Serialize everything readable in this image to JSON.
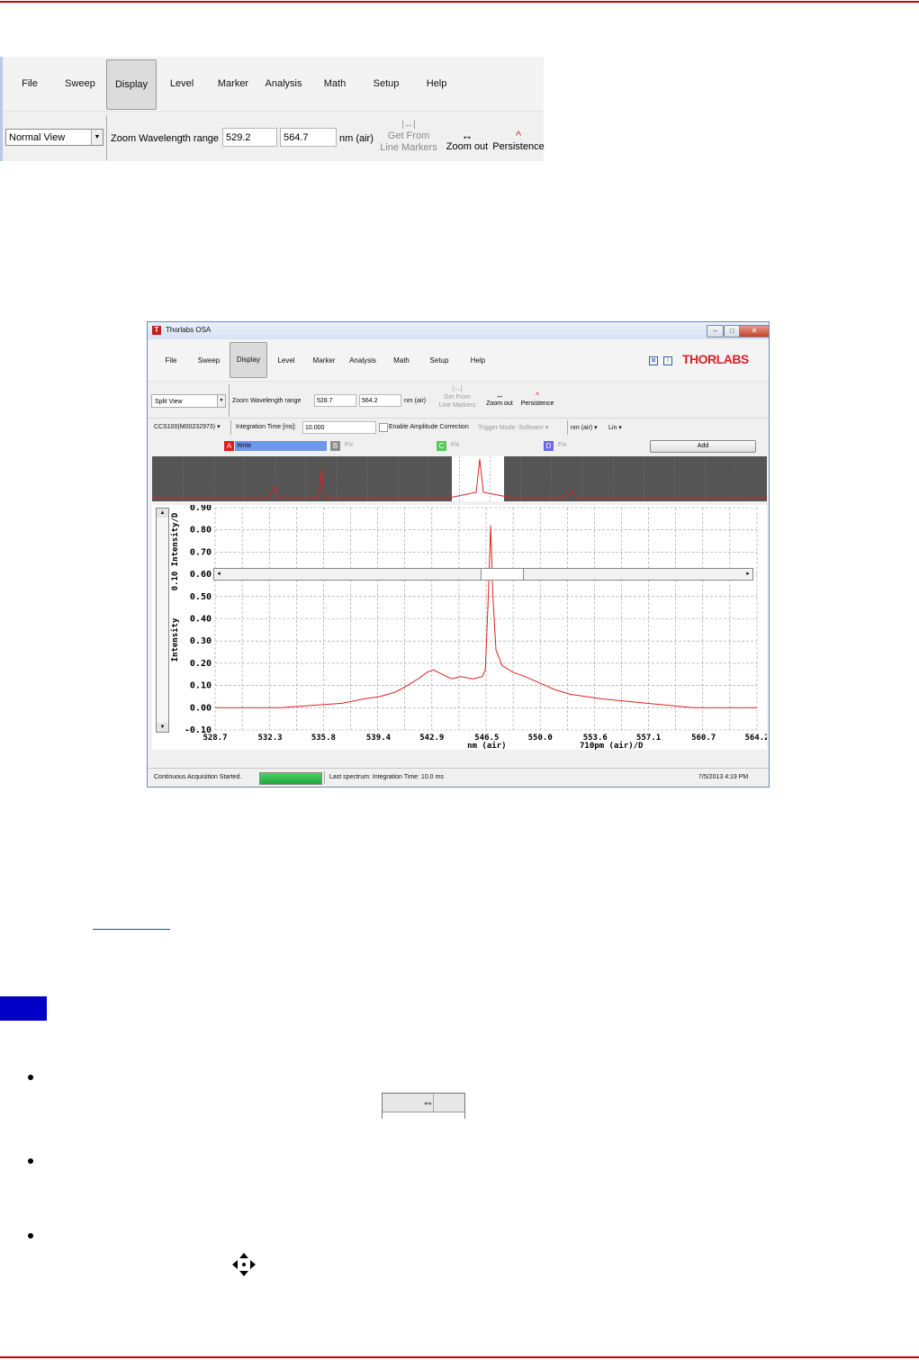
{
  "ribbon_crop": {
    "menu": [
      "File",
      "Sweep",
      "Display",
      "Level",
      "Marker",
      "Analysis",
      "Math",
      "Setup",
      "Help"
    ],
    "active_menu": "Display",
    "view_select": "Normal View",
    "zoom_label": "Zoom Wavelength range",
    "zoom_from": "529.2",
    "zoom_to": "564.7",
    "unit": "nm (air)",
    "get_from_markers": [
      "Get From",
      "Line Markers"
    ],
    "zoom_out": "Zoom out",
    "persistence": "Persistence"
  },
  "window": {
    "title": "Thorlabs OSA",
    "logo_letter": "T",
    "brand": "THORLABS",
    "menu": [
      "File",
      "Sweep",
      "Display",
      "Level",
      "Marker",
      "Analysis",
      "Math",
      "Setup",
      "Help"
    ],
    "active_menu": "Display",
    "view_select": "Split View",
    "zoom_label": "Zoom Wavelength range",
    "zoom_from": "528.7",
    "zoom_to": "564.2",
    "unit": "nm (air)",
    "get_from_markers": [
      "Get From",
      "Line Markers"
    ],
    "zoom_out": "Zoom out",
    "persistence": "Persistence",
    "device_select": "CCS100(M00232973)",
    "integration_label": "Integration Time [ms]:",
    "integration_value": "10.000",
    "amplitude_correction": "Enable Amplitude Correction",
    "trigger_mode": "Trigger Mode: Software",
    "unit_select": "nm (air)",
    "scale_select": "Lin",
    "traces": [
      {
        "key": "A",
        "label": "Write",
        "color": "#e01c1c"
      },
      {
        "key": "B",
        "label": "Fix",
        "color": "#8c8c8c"
      },
      {
        "key": "C",
        "label": "Fix",
        "color": "#57c957"
      },
      {
        "key": "D",
        "label": "Fix",
        "color": "#6a6ae6"
      }
    ],
    "add_button": "Add",
    "status_left": "Continuous Acquisition Started.",
    "status_mid": "Last spectrum: Integration Time: 10.0 ms",
    "status_right": "7/5/2013 4:19 PM"
  },
  "chart_data": {
    "type": "line",
    "title": "",
    "xlabel": "nm (air)",
    "xlabel_division": "710pm (air)/D",
    "ylabel": "Intensity",
    "ylabel_division": "0.10 Intensity/D",
    "xlim": [
      528.7,
      564.2
    ],
    "ylim": [
      -0.1,
      0.9
    ],
    "x_ticks": [
      "528.7",
      "532.3",
      "535.8",
      "539.4",
      "542.9",
      "546.5",
      "550.0",
      "553.6",
      "557.1",
      "560.7",
      "564.2"
    ],
    "y_ticks": [
      "0.90",
      "0.80",
      "0.70",
      "0.60",
      "0.50",
      "0.40",
      "0.30",
      "0.20",
      "0.10",
      "0.00",
      "-0.10"
    ],
    "series": [
      {
        "color": "#e02020",
        "x": [
          528.7,
          531.0,
          533.0,
          535.0,
          537.0,
          538.5,
          539.5,
          540.5,
          541.3,
          542.0,
          542.6,
          543.0,
          543.6,
          544.2,
          544.8,
          545.6,
          546.2,
          546.4,
          546.6,
          546.75,
          546.9,
          547.1,
          547.5,
          548.2,
          549.0,
          550.0,
          551.0,
          552.0,
          553.0,
          554.0,
          555.5,
          557.0,
          558.5,
          560.0,
          562.0,
          564.2
        ],
        "y": [
          0.0,
          0.0,
          0.0,
          0.01,
          0.02,
          0.04,
          0.05,
          0.07,
          0.1,
          0.13,
          0.16,
          0.17,
          0.15,
          0.13,
          0.14,
          0.13,
          0.14,
          0.17,
          0.5,
          0.82,
          0.5,
          0.26,
          0.19,
          0.16,
          0.14,
          0.11,
          0.08,
          0.06,
          0.05,
          0.04,
          0.03,
          0.02,
          0.01,
          0.0,
          0.0,
          0.0
        ]
      }
    ],
    "grid": true
  }
}
